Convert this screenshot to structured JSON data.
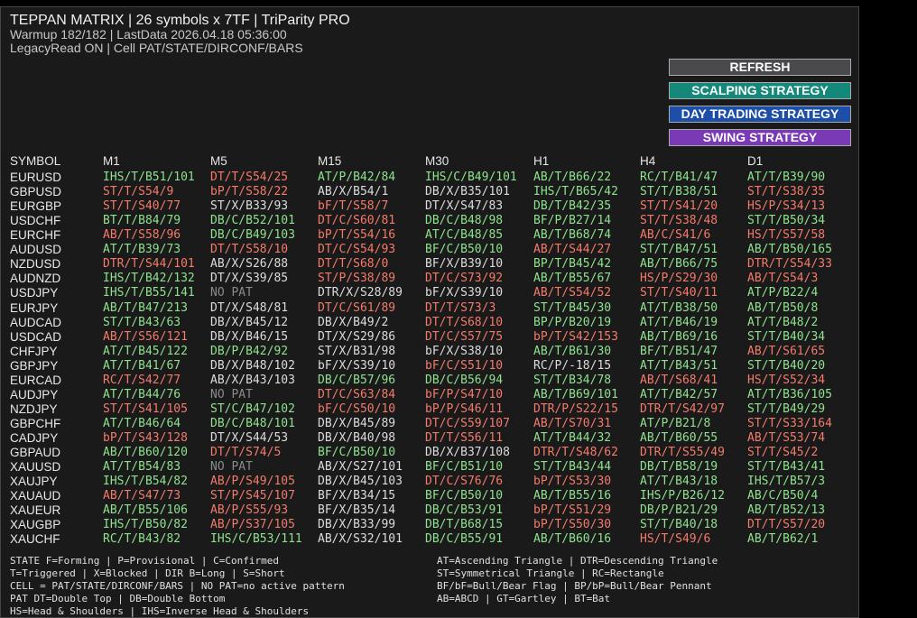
{
  "header": {
    "title": "TEPPAN MATRIX | 26 symbols x 7TF | TriParity PRO",
    "line2": "Warmup 182/182 | LastData 2026.04.18 05:36:00",
    "line3": "LegacyRead ON | Cell PAT/STATE/DIRCONF/BARS"
  },
  "buttons": [
    {
      "label": "REFRESH"
    },
    {
      "label": "SCALPING STRATEGY"
    },
    {
      "label": "DAY TRADING STRATEGY"
    },
    {
      "label": "SWING STRATEGY"
    }
  ],
  "columns": [
    "SYMBOL",
    "M1",
    "M5",
    "M15",
    "M30",
    "H1",
    "H4",
    "D1"
  ],
  "colors": {
    "green": "#8ee28e",
    "red": "#f47a6a",
    "white": "#dcdcdc",
    "gray": "#8a8a8a"
  },
  "rows": [
    {
      "symbol": "EURUSD",
      "cells": [
        [
          "IHS/T/B51/101",
          "g"
        ],
        [
          "DT/T/S54/25",
          "r"
        ],
        [
          "AT/P/B42/84",
          "g"
        ],
        [
          "IHS/C/B49/101",
          "g"
        ],
        [
          "AB/T/B66/22",
          "g"
        ],
        [
          "RC/T/B41/47",
          "g"
        ],
        [
          "AT/T/B39/90",
          "g"
        ]
      ]
    },
    {
      "symbol": "GBPUSD",
      "cells": [
        [
          "ST/T/S54/9",
          "r"
        ],
        [
          "bP/T/S58/22",
          "r"
        ],
        [
          "AB/X/B54/1",
          "w"
        ],
        [
          "DB/X/B35/101",
          "w"
        ],
        [
          "IHS/T/B65/42",
          "g"
        ],
        [
          "ST/T/B38/51",
          "g"
        ],
        [
          "ST/T/S38/35",
          "r"
        ]
      ]
    },
    {
      "symbol": "EURGBP",
      "cells": [
        [
          "ST/T/S40/77",
          "r"
        ],
        [
          "ST/X/B33/93",
          "w"
        ],
        [
          "bF/T/S58/7",
          "r"
        ],
        [
          "DT/X/S47/83",
          "w"
        ],
        [
          "DB/T/B42/35",
          "g"
        ],
        [
          "ST/T/S41/20",
          "r"
        ],
        [
          "HS/P/S34/13",
          "r"
        ]
      ]
    },
    {
      "symbol": "USDCHF",
      "cells": [
        [
          "BT/T/B84/79",
          "g"
        ],
        [
          "DB/C/B52/101",
          "g"
        ],
        [
          "DT/C/S60/81",
          "r"
        ],
        [
          "DB/C/B48/98",
          "g"
        ],
        [
          "BF/P/B27/14",
          "g"
        ],
        [
          "ST/T/S38/48",
          "r"
        ],
        [
          "ST/T/B50/34",
          "g"
        ]
      ]
    },
    {
      "symbol": "EURCHF",
      "cells": [
        [
          "AB/T/S58/96",
          "r"
        ],
        [
          "DB/C/B49/103",
          "g"
        ],
        [
          "bP/T/S54/16",
          "r"
        ],
        [
          "AT/C/B48/85",
          "g"
        ],
        [
          "AB/T/B68/74",
          "g"
        ],
        [
          "AB/C/S41/6",
          "r"
        ],
        [
          "HS/T/S57/58",
          "r"
        ]
      ]
    },
    {
      "symbol": "AUDUSD",
      "cells": [
        [
          "AT/T/B39/73",
          "g"
        ],
        [
          "DT/T/S58/10",
          "r"
        ],
        [
          "DT/C/S54/93",
          "r"
        ],
        [
          "BF/C/B50/10",
          "g"
        ],
        [
          "AB/T/S44/27",
          "r"
        ],
        [
          "ST/T/B47/51",
          "g"
        ],
        [
          "AB/T/B50/165",
          "g"
        ]
      ]
    },
    {
      "symbol": "NZDUSD",
      "cells": [
        [
          "DTR/T/S44/101",
          "r"
        ],
        [
          "AB/X/S26/88",
          "w"
        ],
        [
          "DT/T/S68/0",
          "r"
        ],
        [
          "BF/X/B39/10",
          "w"
        ],
        [
          "BP/T/B45/42",
          "g"
        ],
        [
          "AB/T/B66/75",
          "g"
        ],
        [
          "DTR/T/S54/33",
          "r"
        ]
      ]
    },
    {
      "symbol": "AUDNZD",
      "cells": [
        [
          "IHS/T/B42/132",
          "g"
        ],
        [
          "DT/X/S39/85",
          "w"
        ],
        [
          "ST/P/S38/89",
          "r"
        ],
        [
          "DT/C/S73/92",
          "r"
        ],
        [
          "AB/T/B55/67",
          "g"
        ],
        [
          "HS/P/S29/30",
          "r"
        ],
        [
          "AB/T/S54/3",
          "r"
        ]
      ]
    },
    {
      "symbol": "USDJPY",
      "cells": [
        [
          "IHS/T/B55/141",
          "g"
        ],
        [
          "NO PAT",
          "x"
        ],
        [
          "DTR/X/S28/89",
          "w"
        ],
        [
          "bF/X/S39/10",
          "w"
        ],
        [
          "AB/T/S54/52",
          "r"
        ],
        [
          "ST/T/S40/11",
          "r"
        ],
        [
          "AT/P/B22/4",
          "g"
        ]
      ]
    },
    {
      "symbol": "EURJPY",
      "cells": [
        [
          "AB/T/B47/213",
          "g"
        ],
        [
          "DT/X/S48/81",
          "w"
        ],
        [
          "DT/C/S61/89",
          "r"
        ],
        [
          "DT/T/S73/3",
          "r"
        ],
        [
          "ST/T/B45/30",
          "g"
        ],
        [
          "AT/T/B38/50",
          "g"
        ],
        [
          "AB/T/B50/8",
          "g"
        ]
      ]
    },
    {
      "symbol": "AUDCAD",
      "cells": [
        [
          "ST/T/B43/63",
          "g"
        ],
        [
          "DB/X/B45/12",
          "w"
        ],
        [
          "DB/X/B49/2",
          "w"
        ],
        [
          "DT/T/S68/10",
          "r"
        ],
        [
          "BP/P/B20/19",
          "g"
        ],
        [
          "AT/T/B46/19",
          "g"
        ],
        [
          "AT/T/B48/2",
          "g"
        ]
      ]
    },
    {
      "symbol": "USDCAD",
      "cells": [
        [
          "AB/T/S56/121",
          "r"
        ],
        [
          "DB/X/B46/15",
          "w"
        ],
        [
          "DT/X/S29/86",
          "w"
        ],
        [
          "DT/C/S57/75",
          "r"
        ],
        [
          "bP/T/S42/153",
          "r"
        ],
        [
          "AB/T/B69/16",
          "g"
        ],
        [
          "ST/T/B40/34",
          "g"
        ]
      ]
    },
    {
      "symbol": "CHFJPY",
      "cells": [
        [
          "AT/T/B45/122",
          "g"
        ],
        [
          "DB/P/B42/92",
          "g"
        ],
        [
          "ST/X/B31/98",
          "w"
        ],
        [
          "bF/X/S38/10",
          "w"
        ],
        [
          "AB/T/B61/30",
          "g"
        ],
        [
          "BF/T/B51/47",
          "g"
        ],
        [
          "AB/T/S61/65",
          "r"
        ]
      ]
    },
    {
      "symbol": "GBPJPY",
      "cells": [
        [
          "AT/T/B41/67",
          "g"
        ],
        [
          "DB/X/B48/102",
          "w"
        ],
        [
          "bF/X/S39/10",
          "w"
        ],
        [
          "bF/C/S51/10",
          "r"
        ],
        [
          "RC/P/-18/15",
          "w"
        ],
        [
          "AT/T/B43/51",
          "g"
        ],
        [
          "ST/T/B40/20",
          "g"
        ]
      ]
    },
    {
      "symbol": "EURCAD",
      "cells": [
        [
          "RC/T/S42/77",
          "r"
        ],
        [
          "AB/X/B43/103",
          "w"
        ],
        [
          "DB/C/B57/96",
          "g"
        ],
        [
          "DB/C/B56/94",
          "g"
        ],
        [
          "ST/T/B34/78",
          "g"
        ],
        [
          "AB/T/S68/41",
          "r"
        ],
        [
          "HS/T/S52/34",
          "r"
        ]
      ]
    },
    {
      "symbol": "AUDJPY",
      "cells": [
        [
          "AT/T/B44/76",
          "g"
        ],
        [
          "NO PAT",
          "x"
        ],
        [
          "DT/C/S63/84",
          "r"
        ],
        [
          "bF/P/S47/10",
          "r"
        ],
        [
          "AB/T/B69/101",
          "g"
        ],
        [
          "AT/T/B42/57",
          "g"
        ],
        [
          "AT/T/B36/105",
          "g"
        ]
      ]
    },
    {
      "symbol": "NZDJPY",
      "cells": [
        [
          "ST/T/S41/105",
          "r"
        ],
        [
          "ST/C/B47/102",
          "g"
        ],
        [
          "bF/C/S50/10",
          "r"
        ],
        [
          "bP/P/S46/11",
          "r"
        ],
        [
          "DTR/P/S22/15",
          "r"
        ],
        [
          "DTR/T/S42/97",
          "r"
        ],
        [
          "ST/T/B49/29",
          "g"
        ]
      ]
    },
    {
      "symbol": "GBPCHF",
      "cells": [
        [
          "AT/T/B46/64",
          "g"
        ],
        [
          "DB/C/B48/101",
          "g"
        ],
        [
          "DB/X/B45/89",
          "w"
        ],
        [
          "DT/C/S59/107",
          "r"
        ],
        [
          "AB/T/S70/31",
          "r"
        ],
        [
          "AT/P/B21/8",
          "g"
        ],
        [
          "ST/T/S33/164",
          "r"
        ]
      ]
    },
    {
      "symbol": "CADJPY",
      "cells": [
        [
          "bP/T/S43/128",
          "r"
        ],
        [
          "DT/X/S44/53",
          "w"
        ],
        [
          "DB/X/B40/98",
          "w"
        ],
        [
          "DT/T/S56/11",
          "r"
        ],
        [
          "AT/T/B44/32",
          "g"
        ],
        [
          "AB/T/B60/55",
          "g"
        ],
        [
          "AB/T/S53/74",
          "r"
        ]
      ]
    },
    {
      "symbol": "GBPAUD",
      "cells": [
        [
          "AB/T/B60/120",
          "g"
        ],
        [
          "DT/T/S74/5",
          "r"
        ],
        [
          "BF/C/B50/10",
          "g"
        ],
        [
          "DB/X/B37/108",
          "w"
        ],
        [
          "DTR/T/S48/62",
          "r"
        ],
        [
          "DTR/T/S55/49",
          "r"
        ],
        [
          "ST/T/S45/2",
          "r"
        ]
      ]
    },
    {
      "symbol": "XAUUSD",
      "cells": [
        [
          "AT/T/B54/83",
          "g"
        ],
        [
          "NO PAT",
          "x"
        ],
        [
          "AB/X/S27/101",
          "w"
        ],
        [
          "BF/C/B51/10",
          "g"
        ],
        [
          "ST/T/B43/44",
          "g"
        ],
        [
          "DB/T/B58/19",
          "g"
        ],
        [
          "ST/T/B43/41",
          "g"
        ]
      ]
    },
    {
      "symbol": "XAUJPY",
      "cells": [
        [
          "IHS/T/B54/82",
          "g"
        ],
        [
          "AB/P/S49/105",
          "r"
        ],
        [
          "DB/X/B45/103",
          "w"
        ],
        [
          "DT/C/S76/76",
          "r"
        ],
        [
          "bP/T/S53/30",
          "r"
        ],
        [
          "AT/T/B43/18",
          "g"
        ],
        [
          "IHS/T/B57/3",
          "g"
        ]
      ]
    },
    {
      "symbol": "XAUAUD",
      "cells": [
        [
          "AB/T/S47/73",
          "r"
        ],
        [
          "ST/P/S45/107",
          "r"
        ],
        [
          "BF/X/B34/15",
          "w"
        ],
        [
          "BF/C/B50/10",
          "g"
        ],
        [
          "AB/T/B55/16",
          "g"
        ],
        [
          "IHS/P/B26/12",
          "g"
        ],
        [
          "AB/C/B50/4",
          "g"
        ]
      ]
    },
    {
      "symbol": "XAUEUR",
      "cells": [
        [
          "AB/T/B55/106",
          "g"
        ],
        [
          "AB/P/S55/93",
          "r"
        ],
        [
          "BF/X/B35/14",
          "w"
        ],
        [
          "DB/C/B53/91",
          "g"
        ],
        [
          "bP/T/S51/29",
          "r"
        ],
        [
          "DB/P/B21/29",
          "g"
        ],
        [
          "AB/T/B52/13",
          "g"
        ]
      ]
    },
    {
      "symbol": "XAUGBP",
      "cells": [
        [
          "IHS/T/B50/82",
          "g"
        ],
        [
          "AB/P/S37/105",
          "r"
        ],
        [
          "DB/X/B33/99",
          "w"
        ],
        [
          "DB/T/B68/15",
          "g"
        ],
        [
          "bP/T/S50/30",
          "r"
        ],
        [
          "ST/T/B40/18",
          "g"
        ],
        [
          "DT/T/S57/20",
          "r"
        ]
      ]
    },
    {
      "symbol": "XAUCHF",
      "cells": [
        [
          "RC/T/B43/82",
          "g"
        ],
        [
          "IHS/C/B53/111",
          "g"
        ],
        [
          "AB/X/S32/101",
          "w"
        ],
        [
          "DB/C/B55/91",
          "g"
        ],
        [
          "AB/T/B60/16",
          "g"
        ],
        [
          "HS/T/S49/6",
          "r"
        ],
        [
          "AB/T/B62/1",
          "g"
        ]
      ]
    }
  ],
  "legend_left": [
    "STATE F=Forming | P=Provisional | C=Confirmed",
    "T=Triggered | X=Blocked | DIR B=Long | S=Short",
    "CELL = PAT/STATE/DIRCONF/BARS | NO PAT=no active pattern",
    "PAT DT=Double Top | DB=Double Bottom",
    "HS=Head & Shoulders | IHS=Inverse Head & Shoulders"
  ],
  "legend_right": [
    "AT=Ascending Triangle | DTR=Descending Triangle",
    "ST=Symmetrical Triangle | RC=Rectangle",
    "BF/bF=Bull/Bear Flag | BP/bP=Bull/Bear Pennant",
    "AB=ABCD | GT=Gartley | BT=Bat"
  ]
}
